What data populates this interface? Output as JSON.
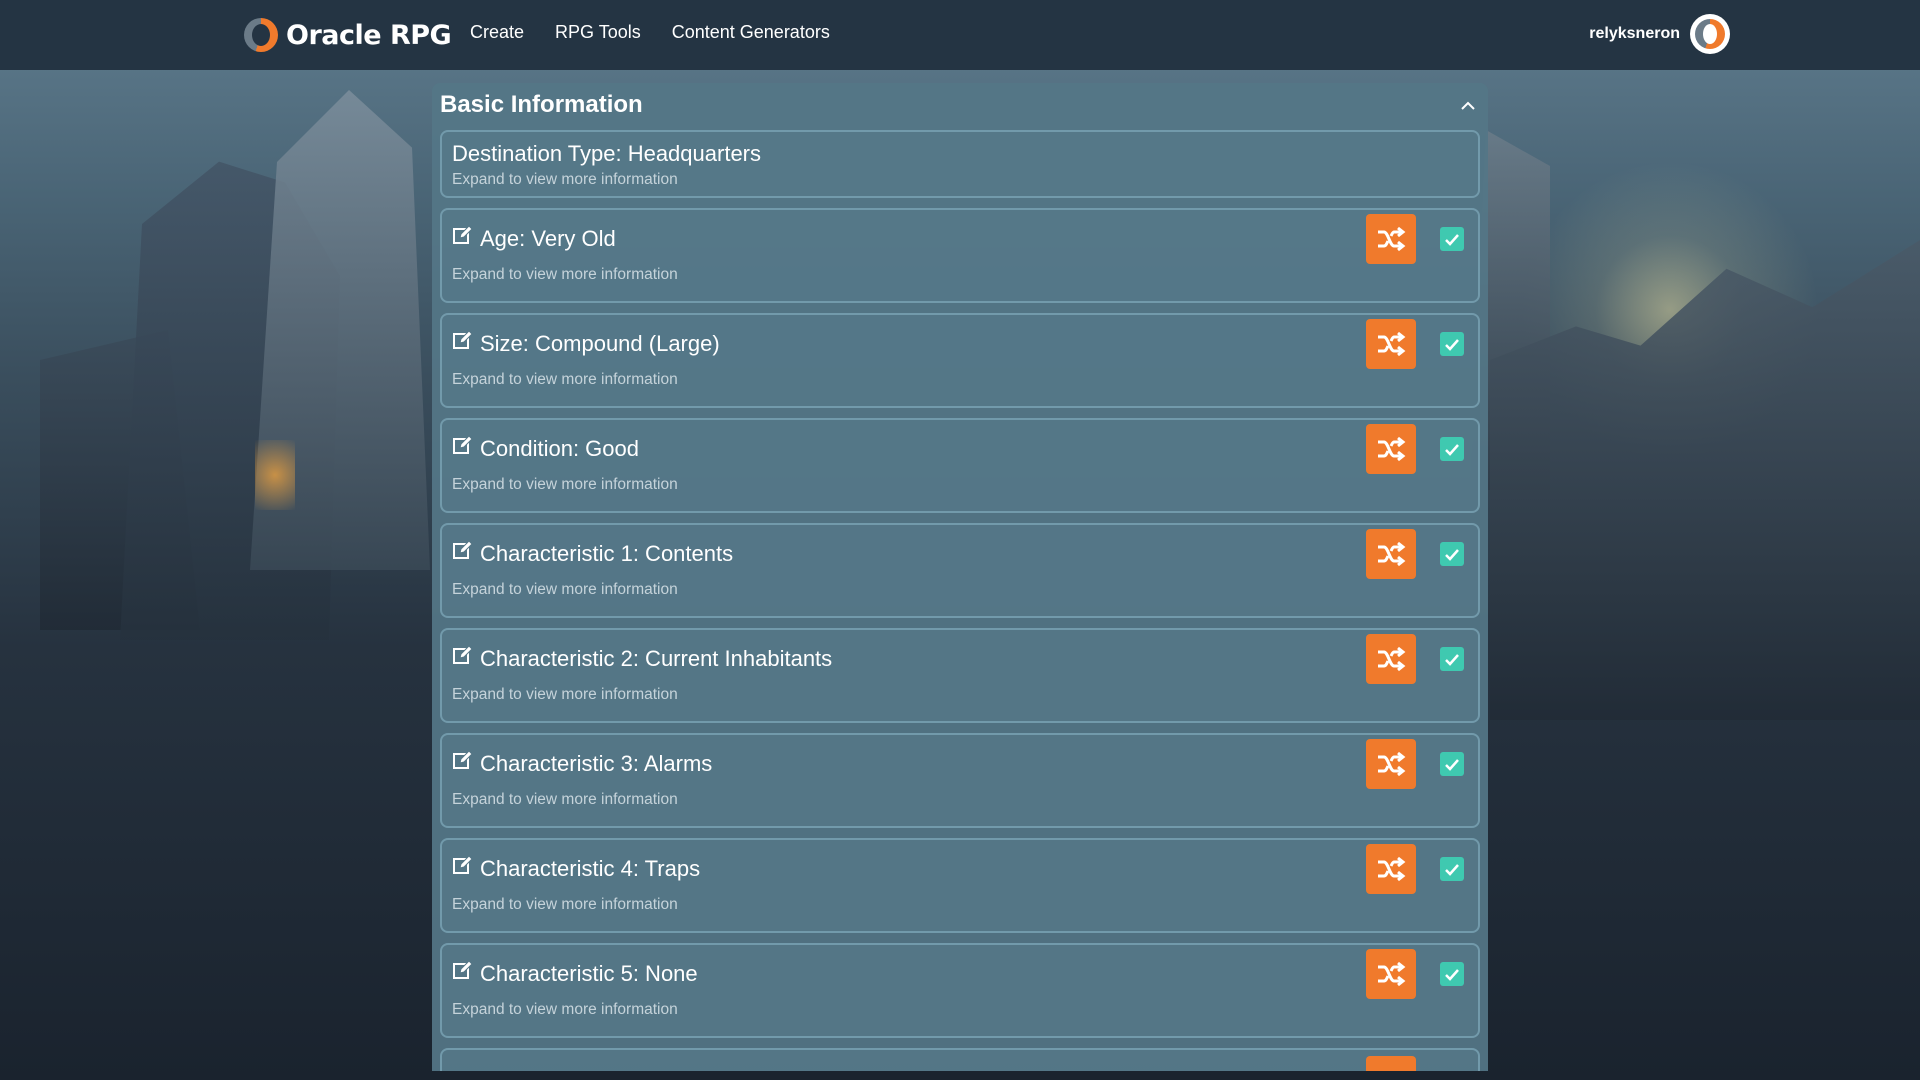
{
  "header": {
    "brand": "Oracle RPG",
    "nav": [
      "Create",
      "RPG Tools",
      "Content Generators"
    ],
    "username": "relyksneron"
  },
  "panel": {
    "title": "Basic Information",
    "destination": {
      "title": "Destination Type: Headquarters",
      "subtitle": "Expand to view more information"
    },
    "items": [
      {
        "title": "Age: Very Old",
        "subtitle": "Expand to view more information",
        "checked": true
      },
      {
        "title": "Size: Compound (Large)",
        "subtitle": "Expand to view more information",
        "checked": true
      },
      {
        "title": "Condition: Good",
        "subtitle": "Expand to view more information",
        "checked": true
      },
      {
        "title": "Characteristic 1: Contents",
        "subtitle": "Expand to view more information",
        "checked": true
      },
      {
        "title": "Characteristic 2: Current Inhabitants",
        "subtitle": "Expand to view more information",
        "checked": true
      },
      {
        "title": "Characteristic 3: Alarms",
        "subtitle": "Expand to view more information",
        "checked": true
      },
      {
        "title": "Characteristic 4: Traps",
        "subtitle": "Expand to view more information",
        "checked": true
      },
      {
        "title": "Characteristic 5: None",
        "subtitle": "Expand to view more information",
        "checked": true
      }
    ]
  },
  "colors": {
    "header_bg": "#243443",
    "panel_bg": "#547686",
    "accent_orange": "#f07a2c",
    "check_teal": "#3fc9b0"
  },
  "icons": {
    "edit": "edit-icon",
    "shuffle": "shuffle-icon",
    "check": "check-icon",
    "collapse": "chevron-up-icon"
  }
}
